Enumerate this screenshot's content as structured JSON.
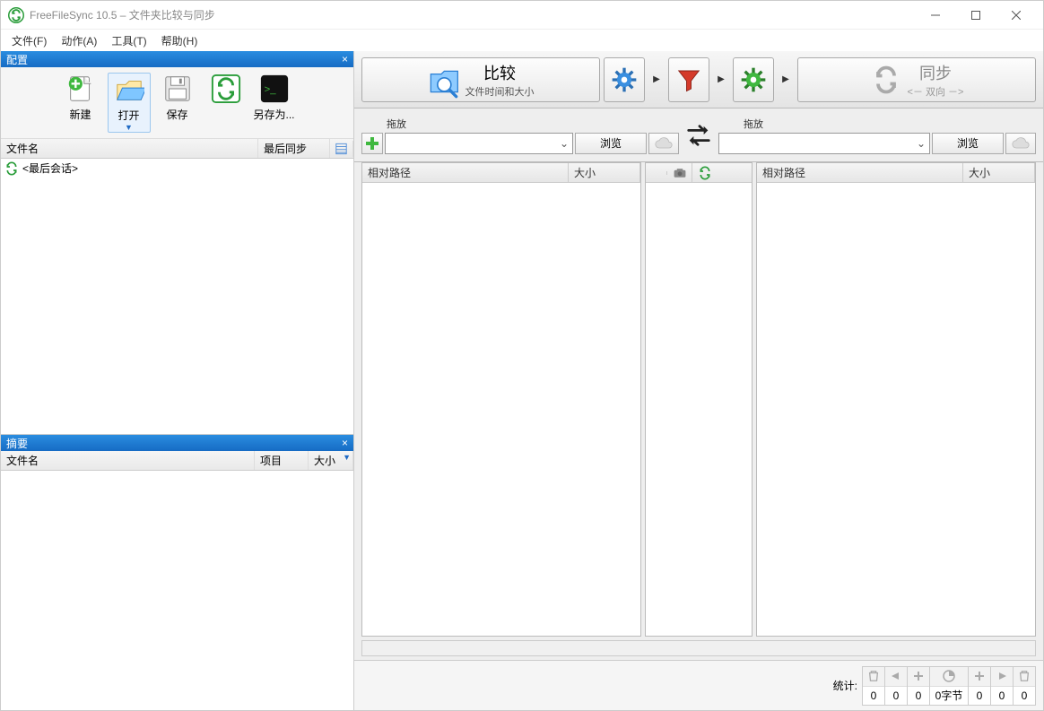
{
  "title": "FreeFileSync 10.5 – 文件夹比较与同步",
  "menu": {
    "file": "文件(F)",
    "action": "动作(A)",
    "tools": "工具(T)",
    "help": "帮助(H)"
  },
  "config_panel": {
    "title": "配置",
    "buttons": {
      "new": "新建",
      "open": "打开",
      "save": "保存",
      "save_as": "另存为..."
    },
    "col_name": "文件名",
    "col_last_sync": "最后同步",
    "items": [
      {
        "label": "<最后会话>"
      }
    ]
  },
  "summary_panel": {
    "title": "摘要",
    "col_name": "文件名",
    "col_items": "项目",
    "col_size": "大小"
  },
  "actions": {
    "compare": "比较",
    "compare_sub": "文件时间和大小",
    "sync": "同步",
    "sync_sub": "<－ 双向 －>"
  },
  "pair": {
    "drag_label": "拖放",
    "browse": "浏览"
  },
  "grid": {
    "col_relpath": "相对路径",
    "col_size": "大小"
  },
  "status": {
    "label": "统计:",
    "vals": [
      "0",
      "0",
      "0",
      "0字节",
      "0",
      "0",
      "0"
    ]
  }
}
